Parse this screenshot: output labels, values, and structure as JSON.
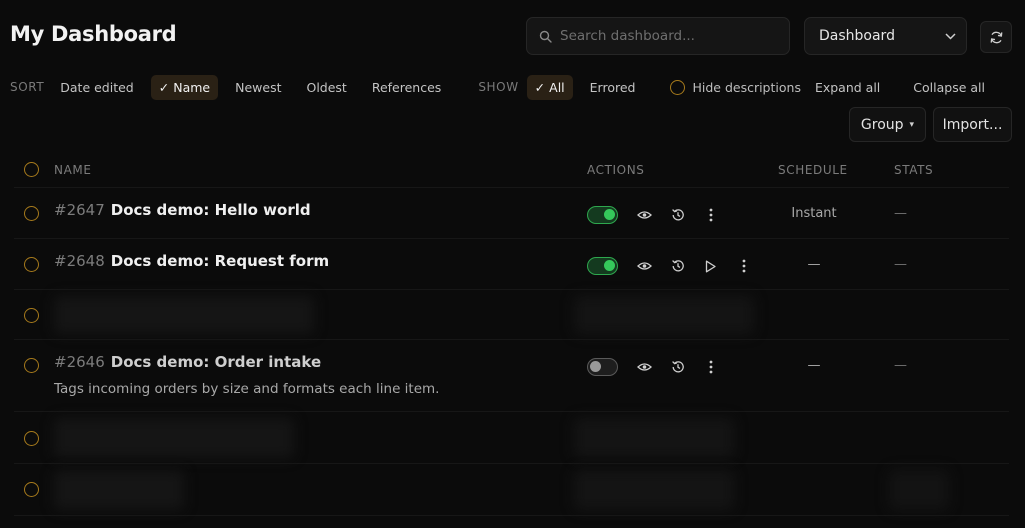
{
  "header": {
    "title": "My Dashboard",
    "search_placeholder": "Search dashboard...",
    "view_select": "Dashboard",
    "refresh_icon": "refresh-icon"
  },
  "filters": {
    "sort_label": "SORT",
    "sort_options": [
      "Date edited",
      "Name",
      "Newest",
      "Oldest",
      "References"
    ],
    "sort_selected": "Name",
    "show_label": "SHOW",
    "show_options": [
      "All",
      "Errored"
    ],
    "show_selected": "All",
    "check_mark": "✓",
    "hide_descriptions": "Hide descriptions",
    "expand_all": "Expand all",
    "collapse_all": "Collapse all"
  },
  "toolbar": {
    "group_label": "Group",
    "group_caret": "▾",
    "import_label": "Import..."
  },
  "table": {
    "columns": {
      "name": "NAME",
      "actions": "ACTIONS",
      "schedule": "SCHEDULE",
      "stats": "STATS"
    },
    "rows": [
      {
        "id": "#2647",
        "name": "Docs demo: Hello world",
        "enabled": true,
        "has_run": false,
        "schedule": "Instant",
        "stats": "—"
      },
      {
        "id": "#2648",
        "name": "Docs demo: Request form",
        "enabled": true,
        "has_run": true,
        "schedule": "—",
        "stats": "—"
      },
      {
        "id": "#2646",
        "name": "Docs demo: Order intake",
        "description": "Tags incoming orders by size and formats each line item.",
        "enabled": false,
        "has_run": false,
        "schedule": "—",
        "stats": "—"
      }
    ]
  },
  "colors": {
    "accent_ring": "#a67a1c",
    "toggle_on": "#35c95b",
    "active_chip_bg": "#2a2115"
  }
}
